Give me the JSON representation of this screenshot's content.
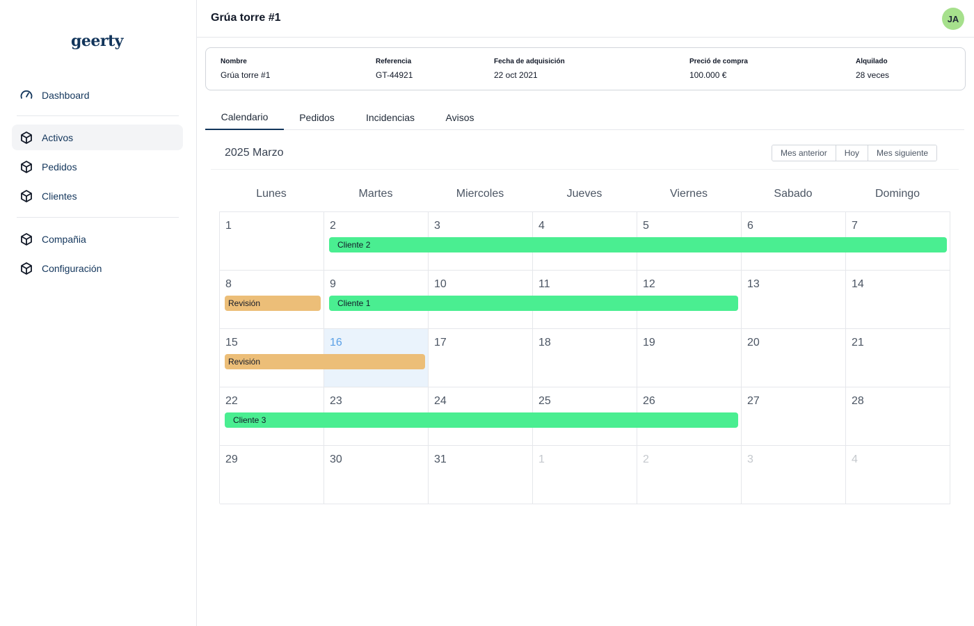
{
  "app": {
    "logo": "geerty"
  },
  "sidebar": {
    "items": [
      {
        "label": "Dashboard",
        "icon": "gauge-icon"
      },
      {
        "label": "Activos",
        "icon": "cube-icon",
        "active": true
      },
      {
        "label": "Pedidos",
        "icon": "cube-icon"
      },
      {
        "label": "Clientes",
        "icon": "cube-icon"
      },
      {
        "label": "Compañia",
        "icon": "cube-icon"
      },
      {
        "label": "Configuración",
        "icon": "cube-icon"
      }
    ]
  },
  "header": {
    "title": "Grúa torre #1",
    "avatar_initials": "JA"
  },
  "info": [
    {
      "label": "Nombre",
      "value": "Grúa torre #1"
    },
    {
      "label": "Referencia",
      "value": "GT-44921"
    },
    {
      "label": "Fecha de adquisición",
      "value": "22 oct 2021"
    },
    {
      "label": "Preció de compra",
      "value": "100.000 €"
    },
    {
      "label": "Alquilado",
      "value": "28 veces"
    }
  ],
  "tabs": [
    {
      "label": "Calendario",
      "active": true
    },
    {
      "label": "Pedidos"
    },
    {
      "label": "Incidencias"
    },
    {
      "label": "Avisos"
    }
  ],
  "calendar": {
    "title": "2025 Marzo",
    "buttons": {
      "prev": "Mes anterior",
      "today": "Hoy",
      "next": "Mes siguiente"
    },
    "weekdays": [
      "Lunes",
      "Martes",
      "Miercoles",
      "Jueves",
      "Viernes",
      "Sabado",
      "Domingo"
    ],
    "weeks": [
      [
        "1",
        "2",
        "3",
        "4",
        "5",
        "6",
        "7"
      ],
      [
        "8",
        "9",
        "10",
        "11",
        "12",
        "13",
        "14"
      ],
      [
        "15",
        "16",
        "17",
        "18",
        "19",
        "20",
        "21"
      ],
      [
        "22",
        "23",
        "24",
        "25",
        "26",
        "27",
        "28"
      ],
      [
        "29",
        "30",
        "31",
        "1",
        "2",
        "3",
        "4"
      ]
    ],
    "today": "16",
    "events": [
      {
        "label": "Cliente 2",
        "color": "#4aee91",
        "start": "2025-03-02",
        "end": "2025-03-07"
      },
      {
        "label": "Revisión",
        "color": "#ecbe78",
        "start": "2025-03-08",
        "end": "2025-03-08"
      },
      {
        "label": "Cliente 1",
        "color": "#4aee91",
        "start": "2025-03-09",
        "end": "2025-03-12"
      },
      {
        "label": "Revisión",
        "color": "#ecbe78",
        "start": "2025-03-15",
        "end": "2025-03-16"
      },
      {
        "label": "Cliente 3",
        "color": "#4aee91",
        "start": "2025-03-22",
        "end": "2025-03-26"
      }
    ]
  }
}
